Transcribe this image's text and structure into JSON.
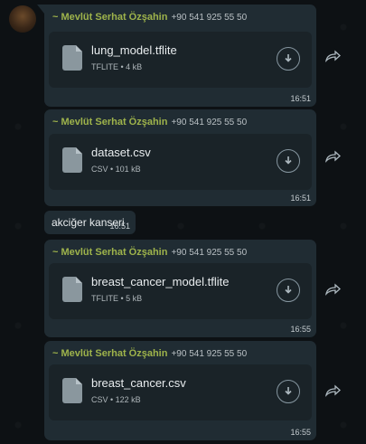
{
  "messages": [
    {
      "sender": "~ Mevlüt Serhat Özşahin",
      "phone": "+90 541 925 55 50",
      "file_name": "lung_model.tflite",
      "file_meta": "TFLITE • 4 kB",
      "time": "16:51"
    },
    {
      "sender": "~ Mevlüt Serhat Özşahin",
      "phone": "+90 541 925 55 50",
      "file_name": "dataset.csv",
      "file_meta": "CSV • 101 kB",
      "time": "16:51"
    },
    {
      "text": "akciğer kanseri",
      "time": "16:51"
    },
    {
      "sender": "~ Mevlüt Serhat Özşahin",
      "phone": "+90 541 925 55 50",
      "file_name": "breast_cancer_model.tflite",
      "file_meta": "TFLITE • 5 kB",
      "time": "16:55"
    },
    {
      "sender": "~ Mevlüt Serhat Özşahin",
      "phone": "+90 541 925 55 50",
      "file_name": "breast_cancer.csv",
      "file_meta": "CSV • 122 kB",
      "time": "16:55"
    }
  ],
  "colors": {
    "sender_name": "#9eb34b",
    "bubble": "#202c33",
    "background": "#0d1114"
  },
  "icons": {
    "file": "document-icon",
    "download": "download-icon",
    "forward": "forward-icon"
  }
}
